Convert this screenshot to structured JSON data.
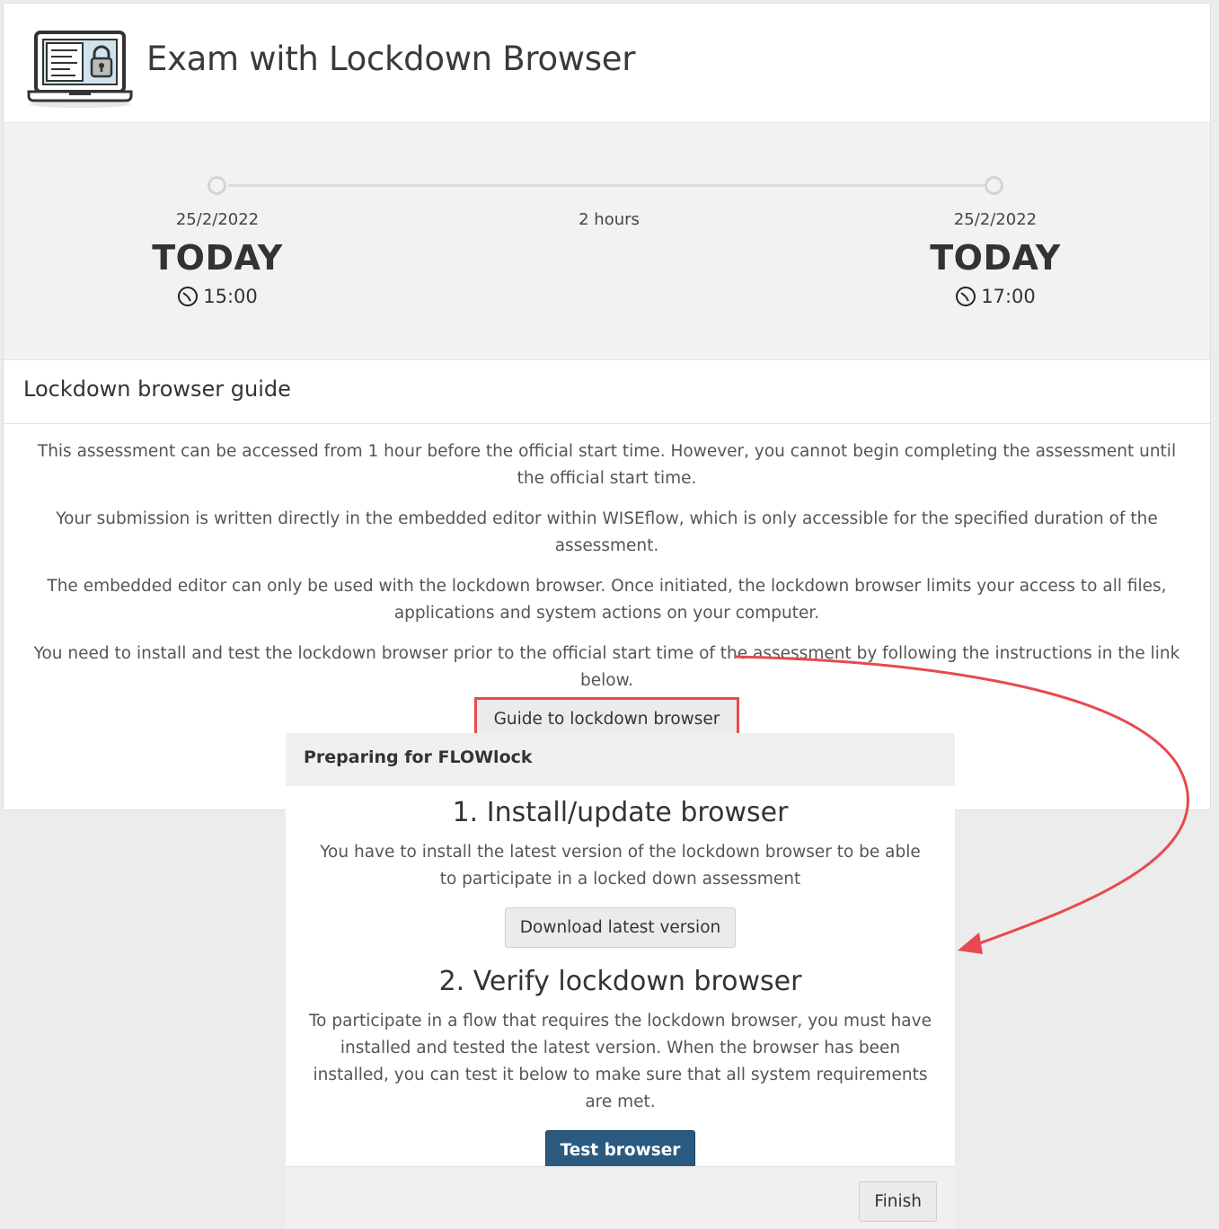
{
  "header": {
    "title": "Exam with Lockdown Browser",
    "icon": "laptop-lock-icon"
  },
  "timeline": {
    "start": {
      "date": "25/2/2022",
      "label": "TODAY",
      "time": "15:00"
    },
    "duration": "2 hours",
    "end": {
      "date": "25/2/2022",
      "label": "TODAY",
      "time": "17:00"
    }
  },
  "guide": {
    "title": "Lockdown browser guide",
    "paragraphs": [
      "This assessment can be accessed from 1 hour before the official start time. However, you cannot begin completing the assessment until the official start time.",
      "Your submission is written directly in the embedded editor within WISEflow, which is only accessible for the specified duration of the assessment.",
      "The embedded editor can only be used with the lockdown browser. Once initiated, the lockdown browser limits your access to all files, applications and system actions on your computer.",
      "You need to install and test the lockdown browser prior to the official start time of the assessment by following the instructions in the link below."
    ],
    "button_label": "Guide to lockdown browser"
  },
  "dialog": {
    "title": "Preparing for FLOWlock",
    "step1": {
      "heading": "1. Install/update browser",
      "text": "You have to install the latest version of the lockdown browser to be able to participate in a locked down assessment",
      "button_label": "Download latest version"
    },
    "step2": {
      "heading": "2. Verify lockdown browser",
      "text": "To participate in a flow that requires the lockdown browser, you must have installed and tested the latest version. When the browser has been installed, you can test it below to make sure that all system requirements are met.",
      "button_label": "Test browser"
    },
    "finish_label": "Finish"
  },
  "colors": {
    "highlight": "#e64a4f",
    "primary_button": "#2b5a80"
  }
}
